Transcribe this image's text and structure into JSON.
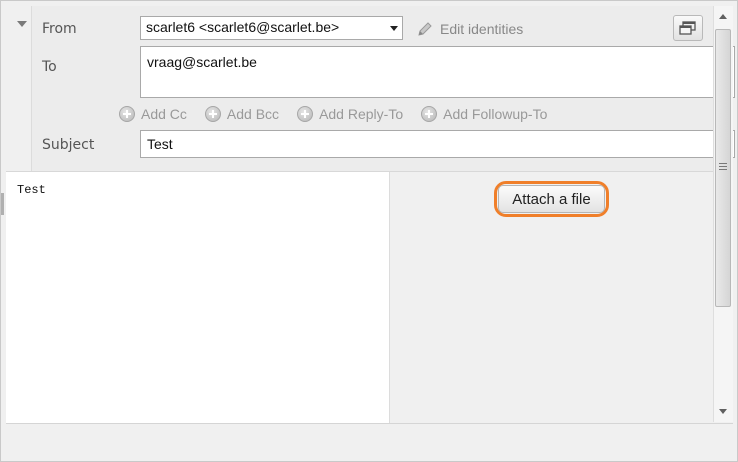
{
  "header": {
    "from_label": "From",
    "from_value": "scarlet6 <scarlet6@scarlet.be>",
    "edit_identities": "Edit identities",
    "to_label": "To",
    "to_value": "vraag@scarlet.be",
    "subject_label": "Subject",
    "subject_value": "Test",
    "add_links": [
      "Add Cc",
      "Add Bcc",
      "Add Reply-To",
      "Add Followup-To"
    ]
  },
  "editor": {
    "body_text": "Test"
  },
  "attachments": {
    "attach_label": "Attach a file",
    "highlight_color": "#f07f2a"
  },
  "icons": {
    "collapse": "chevron-down-icon",
    "edit": "pencil-icon",
    "popout": "popout-window-icon",
    "add": "plus-circle-icon"
  }
}
